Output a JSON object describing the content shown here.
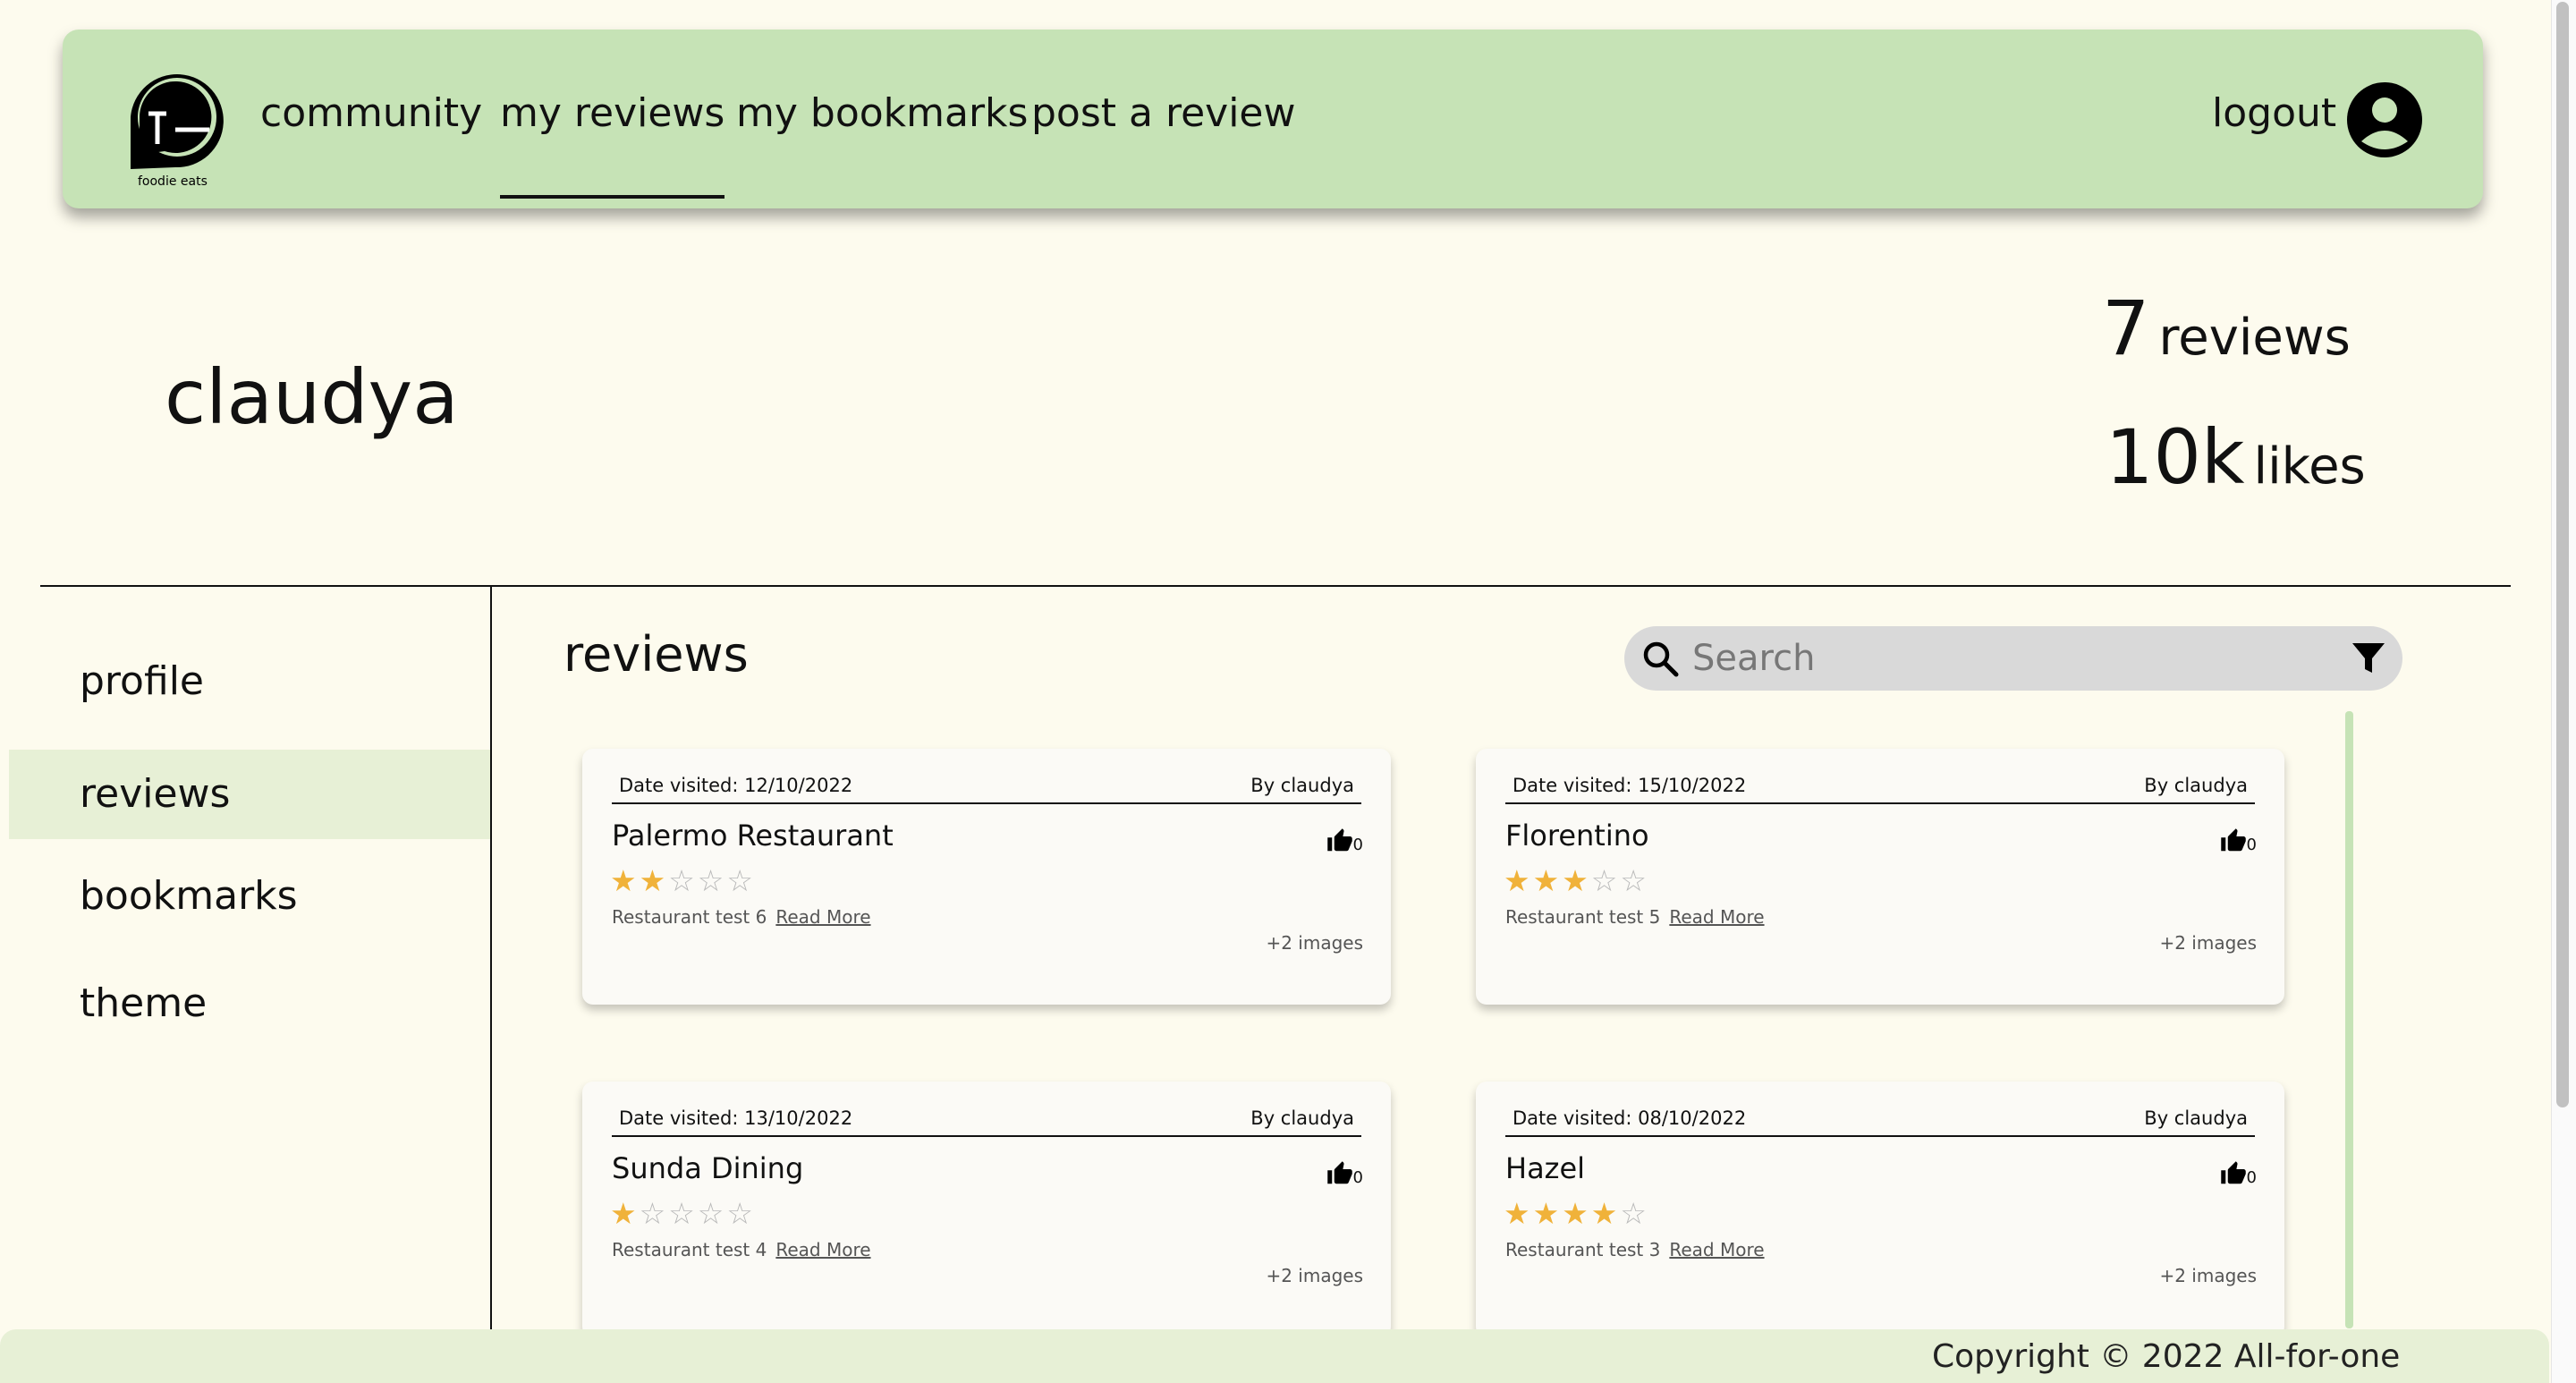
{
  "nav": {
    "logo_text": "foodie eats",
    "links": [
      "community",
      "my reviews",
      "my bookmarks",
      "post a review"
    ],
    "active": "my reviews",
    "logout_label": "logout"
  },
  "profile": {
    "username": "claudya",
    "review_count": "7",
    "review_unit": "reviews",
    "likes_count": "10k",
    "likes_unit": "likes"
  },
  "sidebar": {
    "items": [
      "profile",
      "reviews",
      "bookmarks",
      "theme"
    ],
    "active": "reviews"
  },
  "main": {
    "title": "reviews",
    "search": {
      "placeholder": "Search",
      "value": ""
    }
  },
  "reviews": [
    {
      "date": "Date visited: 12/10/2022",
      "author": "By claudya",
      "name": "Palermo Restaurant",
      "likes": "0",
      "rating": 2,
      "description": "Restaurant test 6",
      "read_more": "Read More",
      "images": "+2 images"
    },
    {
      "date": "Date visited: 15/10/2022",
      "author": "By claudya",
      "name": "Florentino",
      "likes": "0",
      "rating": 3,
      "description": "Restaurant test 5",
      "read_more": "Read More",
      "images": "+2 images"
    },
    {
      "date": "Date visited: 13/10/2022",
      "author": "By claudya",
      "name": "Sunda Dining",
      "likes": "0",
      "rating": 1,
      "description": "Restaurant test 4",
      "read_more": "Read More",
      "images": "+2 images"
    },
    {
      "date": "Date visited: 08/10/2022",
      "author": "By claudya",
      "name": "Hazel",
      "likes": "0",
      "rating": 4,
      "description": "Restaurant test 3",
      "read_more": "Read More",
      "images": "+2 images"
    }
  ],
  "footer": {
    "copyright": "Copyright © 2022 All-for-one"
  },
  "colors": {
    "background": "#fdfbee",
    "navbar": "#c6e3b6",
    "sidebar_active": "#e7f0d6",
    "star": "#f0b23a",
    "search": "#d9d9d9"
  },
  "icons": [
    "foodie-eats-logo",
    "account-circle-icon",
    "search-icon",
    "filter-icon",
    "thumbs-up-icon",
    "star-icon"
  ]
}
